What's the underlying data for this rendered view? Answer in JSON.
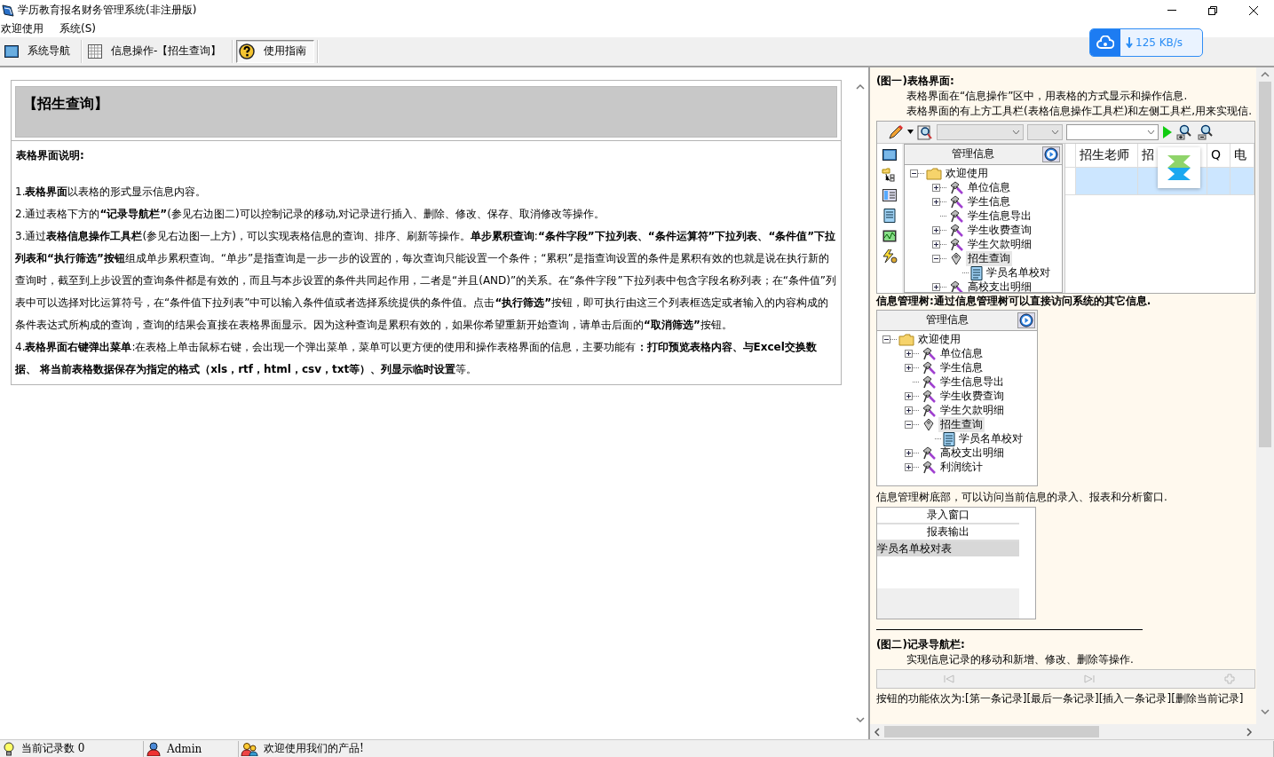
{
  "window": {
    "title": "学历教育报名财务管理系统(非注册版)"
  },
  "menu": [
    {
      "label": "欢迎使用"
    },
    {
      "label": "系统(S)"
    }
  ],
  "tabs": [
    {
      "kind": "navigator",
      "label": "系统导航",
      "selected": false
    },
    {
      "kind": "grid",
      "label": "信息操作-【招生查询】",
      "selected": false
    },
    {
      "kind": "help",
      "label": "使用指南",
      "selected": true
    }
  ],
  "net_speed": {
    "reading": "125 KB/s"
  },
  "guide": {
    "heading": "【招生查询】",
    "subtitle": "表格界面说明:",
    "paragraphs": [
      "1.**表格界面**以表格的形式显示信息内容。",
      "2.通过表格下方的**“记录导航栏”**(参见右边图二)可以控制记录的移动,对记录进行插入、删除、修改、保存、取消修改等操作。",
      "3.通过**表格信息操作工具栏**(参见右边图一上方)，可以实现表格信息的查询、排序、刷新等操作。**单步累积查询**:**“条件字段”下拉列表、“条件运算符”下拉列表、“条件值”下拉列表和“执行筛选”按钮**组成单步累积查询。“单步”是指查询是一步一步的设置的，每次查询只能设置一个条件；“累积”是指查询设置的条件是累积有效的也就是说在执行新的查询时，截至到上步设置的查询条件都是有效的，而且与本步设置的条件共同起作用，二者是“并且(AND)”的关系。在“条件字段”下拉列表中包含字段名称列表；在“条件值”列表中可以选择对比运算符号，在“条件值下拉列表”中可以输入条件值或者选择系统提供的条件值。点击**“执行筛选”**按钮，即可执行由这三个列表框选定或者输入的内容构成的条件表达式所构成的查询，查询的结果会直接在表格界面显示。因为这种查询是累积有效的，如果你希望重新开始查询，请单击后面的**“取消筛选”**按钮。",
      "4.**表格界面右键弹出菜单**:在表格上单击鼠标右键，会出现一个弹出菜单，菜单可以更方便的使用和操作表格界面的信息，主要功能有**：打印预览表格内容、与Excel交换数据、 将当前表格数据保存为指定的格式（xls，rtf，html，csv，txt等）、列显示临时设置**等。"
    ]
  },
  "help": {
    "figure1": {
      "title": "(图一)表格界面:",
      "lines": [
        "表格界面在“信息操作”区中，用表格的方式显示和操作信息.",
        "表格界面的有上方工具栏(表格信息操作工具栏)和左侧工具栏,用来实现信."
      ],
      "tree": {
        "header": "管理信息",
        "items": [
          {
            "kind": "folder",
            "label": "欢迎使用",
            "expanded": true,
            "selected": false,
            "children": [
              {
                "kind": "tool",
                "label": "单位信息",
                "expanded": false,
                "selected": false
              },
              {
                "kind": "tool",
                "label": "学生信息",
                "expanded": false,
                "selected": false
              },
              {
                "kind": "tool",
                "label": "学生信息导出",
                "selected": false
              },
              {
                "kind": "tool",
                "label": "学生收费查询",
                "expanded": false,
                "selected": false
              },
              {
                "kind": "tool",
                "label": "学生欠款明细",
                "expanded": false,
                "selected": false
              },
              {
                "kind": "tool-plain",
                "label": "招生查询",
                "expanded": true,
                "selected": true,
                "children": [
                  {
                    "kind": "document",
                    "label": "学员名单校对",
                    "selected": false
                  }
                ]
              },
              {
                "kind": "tool",
                "label": "高校支出明细",
                "expanded": false,
                "selected": false
              }
            ]
          }
        ]
      },
      "grid": {
        "columns": [
          "招生老师",
          "招",
          "Q",
          "电"
        ]
      }
    },
    "tree_caption": "信息管理树:通过信息管理树可以直接访问系统的其它信息.",
    "tree": {
      "header": "管理信息",
      "items": [
        {
          "kind": "folder",
          "label": "欢迎使用",
          "expanded": true,
          "selected": false,
          "children": [
            {
              "kind": "tool",
              "label": "单位信息",
              "expanded": false,
              "selected": false
            },
            {
              "kind": "tool",
              "label": "学生信息",
              "expanded": false,
              "selected": false
            },
            {
              "kind": "tool",
              "label": "学生信息导出",
              "selected": false
            },
            {
              "kind": "tool",
              "label": "学生收费查询",
              "expanded": false,
              "selected": false
            },
            {
              "kind": "tool",
              "label": "学生欠款明细",
              "expanded": false,
              "selected": false
            },
            {
              "kind": "tool-plain",
              "label": "招生查询",
              "expanded": true,
              "selected": true,
              "children": [
                {
                  "kind": "document",
                  "label": "学员名单校对",
                  "selected": false
                }
              ]
            },
            {
              "kind": "tool",
              "label": "高校支出明细",
              "expanded": false,
              "selected": false
            },
            {
              "kind": "tool",
              "label": "利润统计",
              "expanded": false,
              "selected": false
            }
          ]
        }
      ]
    },
    "windows_caption": "信息管理树底部，可以访问当前信息的录入、报表和分析窗口.",
    "window_list": [
      {
        "kind": "header",
        "label": "录入窗口",
        "selected": false
      },
      {
        "kind": "header",
        "label": "报表输出",
        "selected": false
      },
      {
        "kind": "item",
        "label": "学员名单校对表",
        "selected": true
      }
    ],
    "figure2": {
      "title": "(图二)记录导航栏:",
      "lines": [
        "实现信息记录的移动和新增、修改、删除等操作."
      ],
      "caption": "按钮的功能依次为:[第一条记录][最后一条记录][插入一条记录][删除当前记录]"
    }
  },
  "status_bar": [
    {
      "kind": "records",
      "text": "当前记录数 0"
    },
    {
      "kind": "user",
      "text": "Admin"
    },
    {
      "kind": "message",
      "text": "欢迎使用我们的产品!"
    }
  ]
}
